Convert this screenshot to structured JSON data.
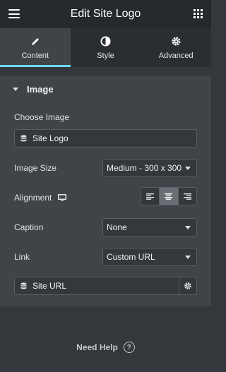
{
  "header": {
    "title": "Edit Site Logo"
  },
  "tabs": [
    {
      "label": "Content",
      "icon": "pencil-icon",
      "active": true
    },
    {
      "label": "Style",
      "icon": "contrast-icon",
      "active": false
    },
    {
      "label": "Advanced",
      "icon": "gear-icon",
      "active": false
    }
  ],
  "section": {
    "title": "Image"
  },
  "fields": {
    "choose_image": {
      "label": "Choose Image",
      "value": "Site Logo"
    },
    "image_size": {
      "label": "Image Size",
      "value": "Medium - 300 x 300"
    },
    "alignment": {
      "label": "Alignment",
      "selected": "center"
    },
    "caption": {
      "label": "Caption",
      "value": "None"
    },
    "link": {
      "label": "Link",
      "value": "Custom URL"
    },
    "site_url": {
      "value": "Site URL"
    }
  },
  "footer": {
    "help_label": "Need Help",
    "help_icon": "?"
  },
  "colors": {
    "accent": "#71d7f7",
    "header_bg": "#26292c",
    "panel_bg": "#404449",
    "body_bg": "#34383c"
  }
}
